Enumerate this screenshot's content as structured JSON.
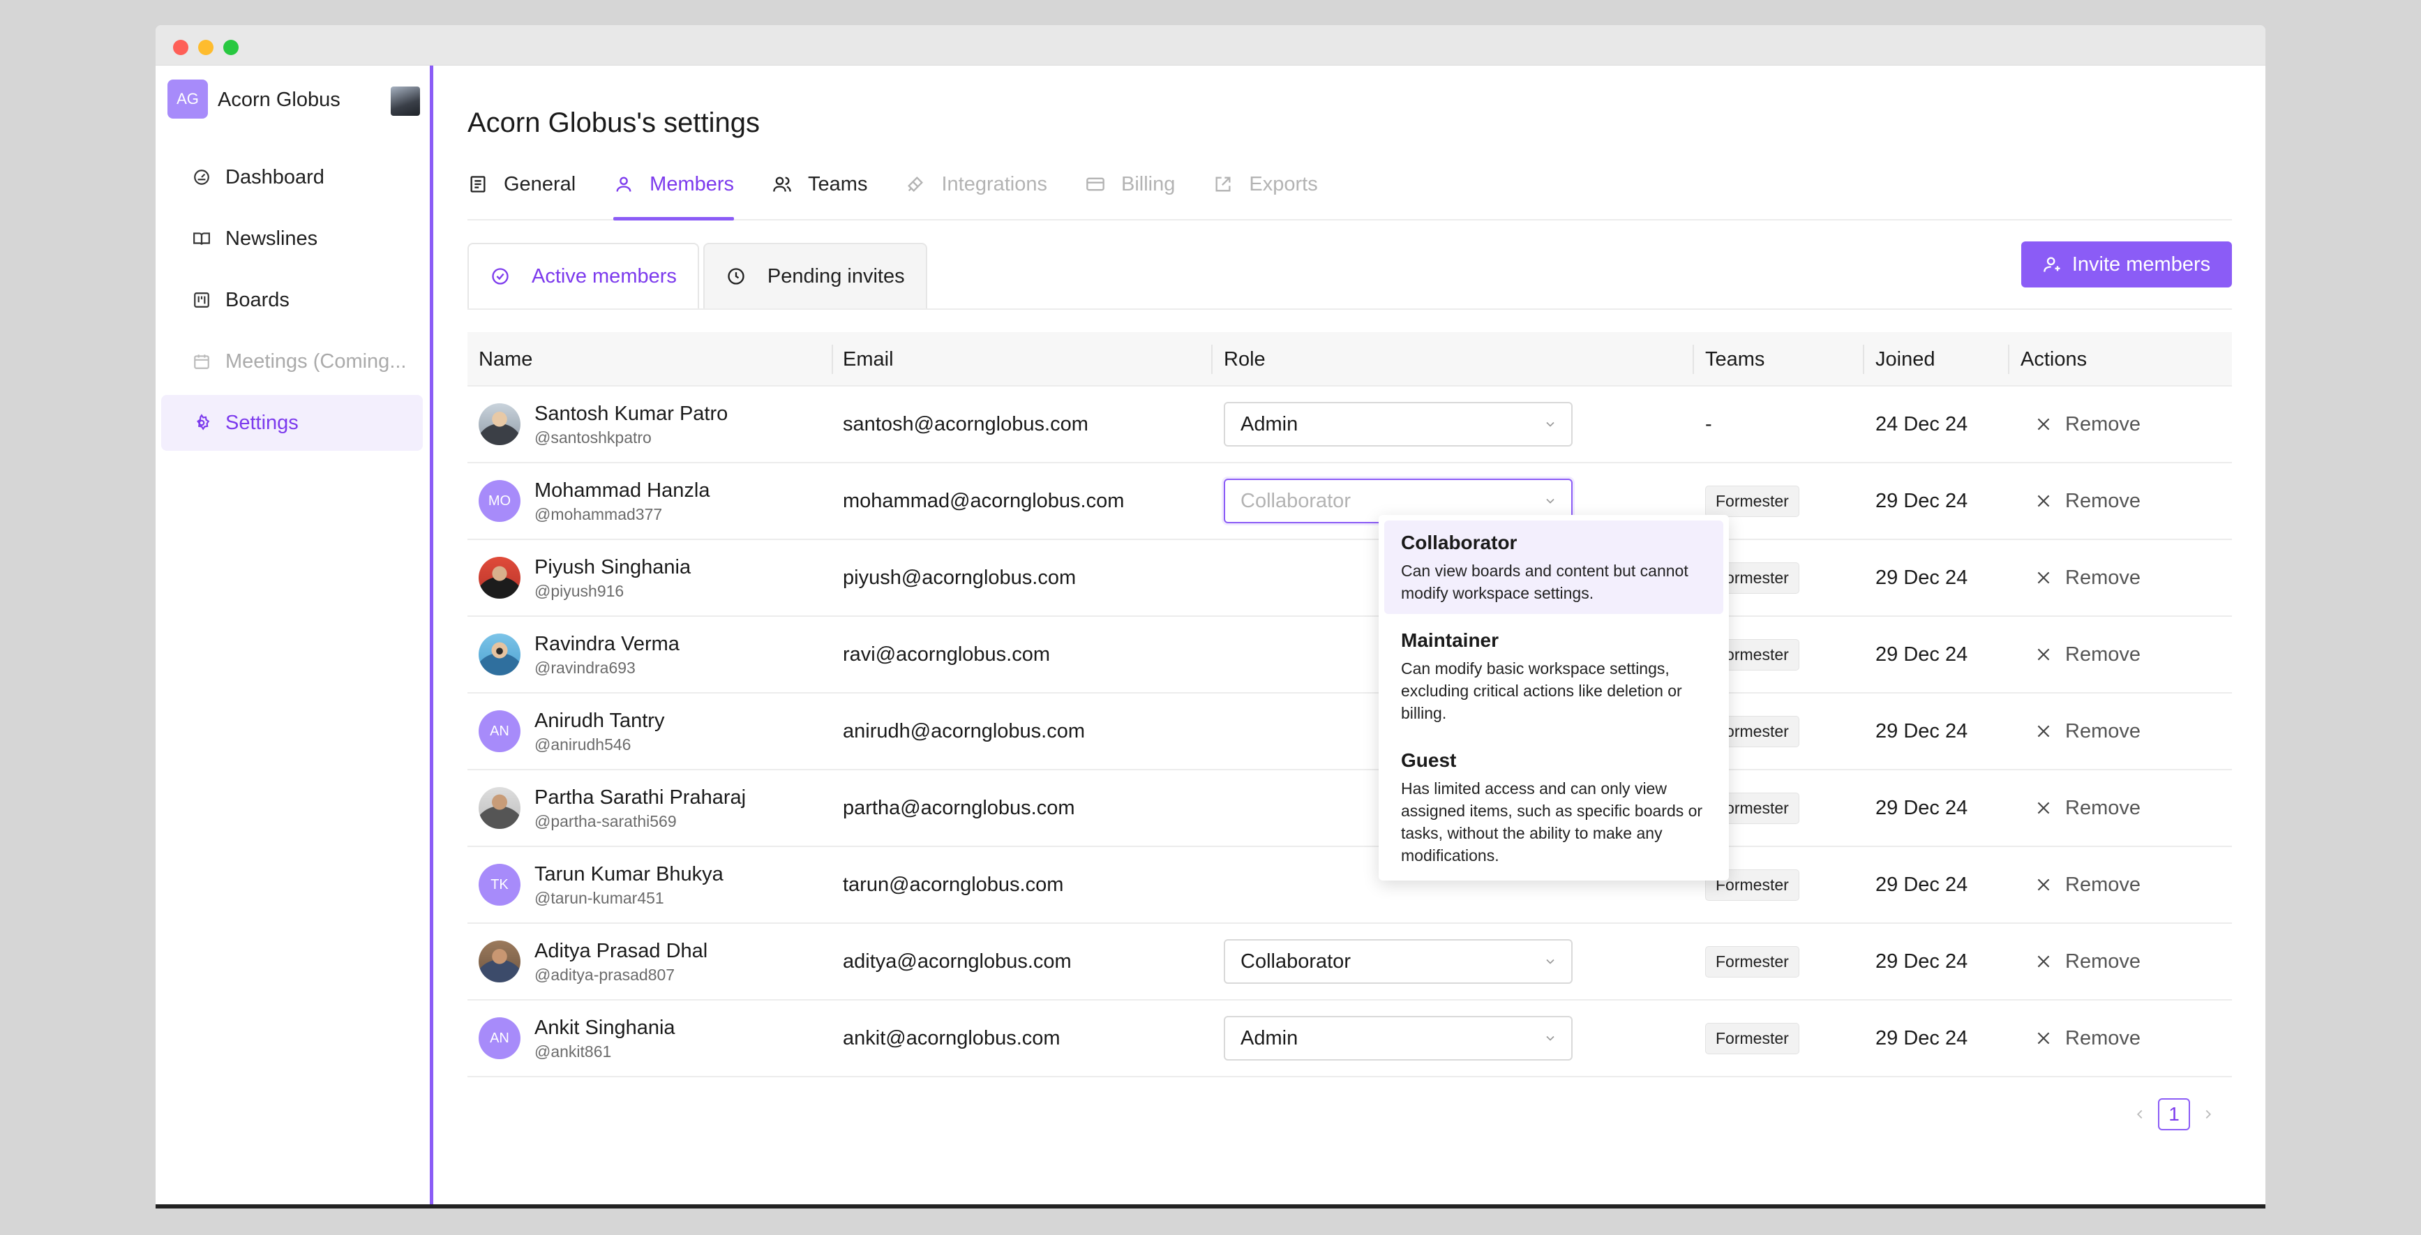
{
  "window": {
    "controls": [
      "close",
      "minimize",
      "maximize"
    ]
  },
  "sidebar": {
    "workspace": {
      "initials": "AG",
      "name": "Acorn Globus"
    },
    "items": [
      {
        "label": "Dashboard",
        "icon": "gauge-icon",
        "state": "normal"
      },
      {
        "label": "Newslines",
        "icon": "book-icon",
        "state": "normal"
      },
      {
        "label": "Boards",
        "icon": "board-icon",
        "state": "normal"
      },
      {
        "label": "Meetings (Coming...",
        "icon": "calendar-icon",
        "state": "disabled"
      },
      {
        "label": "Settings",
        "icon": "gear-icon",
        "state": "active"
      }
    ]
  },
  "page": {
    "title": "Acorn Globus's settings"
  },
  "tabs": [
    {
      "label": "General",
      "state": "normal"
    },
    {
      "label": "Members",
      "state": "active"
    },
    {
      "label": "Teams",
      "state": "normal"
    },
    {
      "label": "Integrations",
      "state": "disabled"
    },
    {
      "label": "Billing",
      "state": "disabled"
    },
    {
      "label": "Exports",
      "state": "disabled"
    }
  ],
  "subtabs": [
    {
      "label": "Active members",
      "state": "active"
    },
    {
      "label": "Pending invites",
      "state": "normal"
    }
  ],
  "invite_button": "Invite members",
  "table": {
    "columns": [
      "Name",
      "Email",
      "Role",
      "Teams",
      "Joined",
      "Actions"
    ],
    "rows": [
      {
        "name": "Santosh Kumar Patro",
        "handle": "@santoshkpatro",
        "avatar": "photo",
        "initials": "",
        "email": "santosh@acornglobus.com",
        "role": "Admin",
        "team": "-",
        "joined": "24 Dec 24",
        "action": "Remove"
      },
      {
        "name": "Mohammad Hanzla",
        "handle": "@mohammad377",
        "avatar": "initials",
        "initials": "MO",
        "email": "mohammad@acornglobus.com",
        "role": "Collaborator",
        "team": "Formester",
        "joined": "29 Dec 24",
        "action": "Remove"
      },
      {
        "name": "Piyush Singhania",
        "handle": "@piyush916",
        "avatar": "photo2",
        "initials": "",
        "email": "piyush@acornglobus.com",
        "role": "",
        "team": "Formester",
        "joined": "29 Dec 24",
        "action": "Remove"
      },
      {
        "name": "Ravindra Verma",
        "handle": "@ravindra693",
        "avatar": "photo3",
        "initials": "",
        "email": "ravi@acornglobus.com",
        "role": "",
        "team": "Formester",
        "joined": "29 Dec 24",
        "action": "Remove"
      },
      {
        "name": "Anirudh Tantry",
        "handle": "@anirudh546",
        "avatar": "initials",
        "initials": "AN",
        "email": "anirudh@acornglobus.com",
        "role": "",
        "team": "Formester",
        "joined": "29 Dec 24",
        "action": "Remove"
      },
      {
        "name": "Partha Sarathi Praharaj",
        "handle": "@partha-sarathi569",
        "avatar": "photo4",
        "initials": "",
        "email": "partha@acornglobus.com",
        "role": "",
        "team": "Formester",
        "joined": "29 Dec 24",
        "action": "Remove"
      },
      {
        "name": "Tarun Kumar Bhukya",
        "handle": "@tarun-kumar451",
        "avatar": "initials",
        "initials": "TK",
        "email": "tarun@acornglobus.com",
        "role": "",
        "team": "Formester",
        "joined": "29 Dec 24",
        "action": "Remove"
      },
      {
        "name": "Aditya Prasad Dhal",
        "handle": "@aditya-prasad807",
        "avatar": "photo5",
        "initials": "",
        "email": "aditya@acornglobus.com",
        "role": "Collaborator",
        "team": "Formester",
        "joined": "29 Dec 24",
        "action": "Remove"
      },
      {
        "name": "Ankit Singhania",
        "handle": "@ankit861",
        "avatar": "initials",
        "initials": "AN",
        "email": "ankit@acornglobus.com",
        "role": "Admin",
        "team": "Formester",
        "joined": "29 Dec 24",
        "action": "Remove"
      }
    ]
  },
  "role_dropdown": {
    "placeholder": "Collaborator",
    "options": [
      {
        "title": "Collaborator",
        "description": "Can view boards and content but cannot modify workspace settings.",
        "highlighted": true
      },
      {
        "title": "Maintainer",
        "description": "Can modify basic workspace settings, excluding critical actions like deletion or billing.",
        "highlighted": false
      },
      {
        "title": "Guest",
        "description": "Has limited access and can only view assigned items, such as specific boards or tasks, without the ability to make any modifications.",
        "highlighted": false
      }
    ]
  },
  "pagination": {
    "current_page": "1"
  },
  "colors": {
    "accent": "#8b5cf6",
    "accent_text": "#7c3aed",
    "active_bg": "#f3effd"
  }
}
